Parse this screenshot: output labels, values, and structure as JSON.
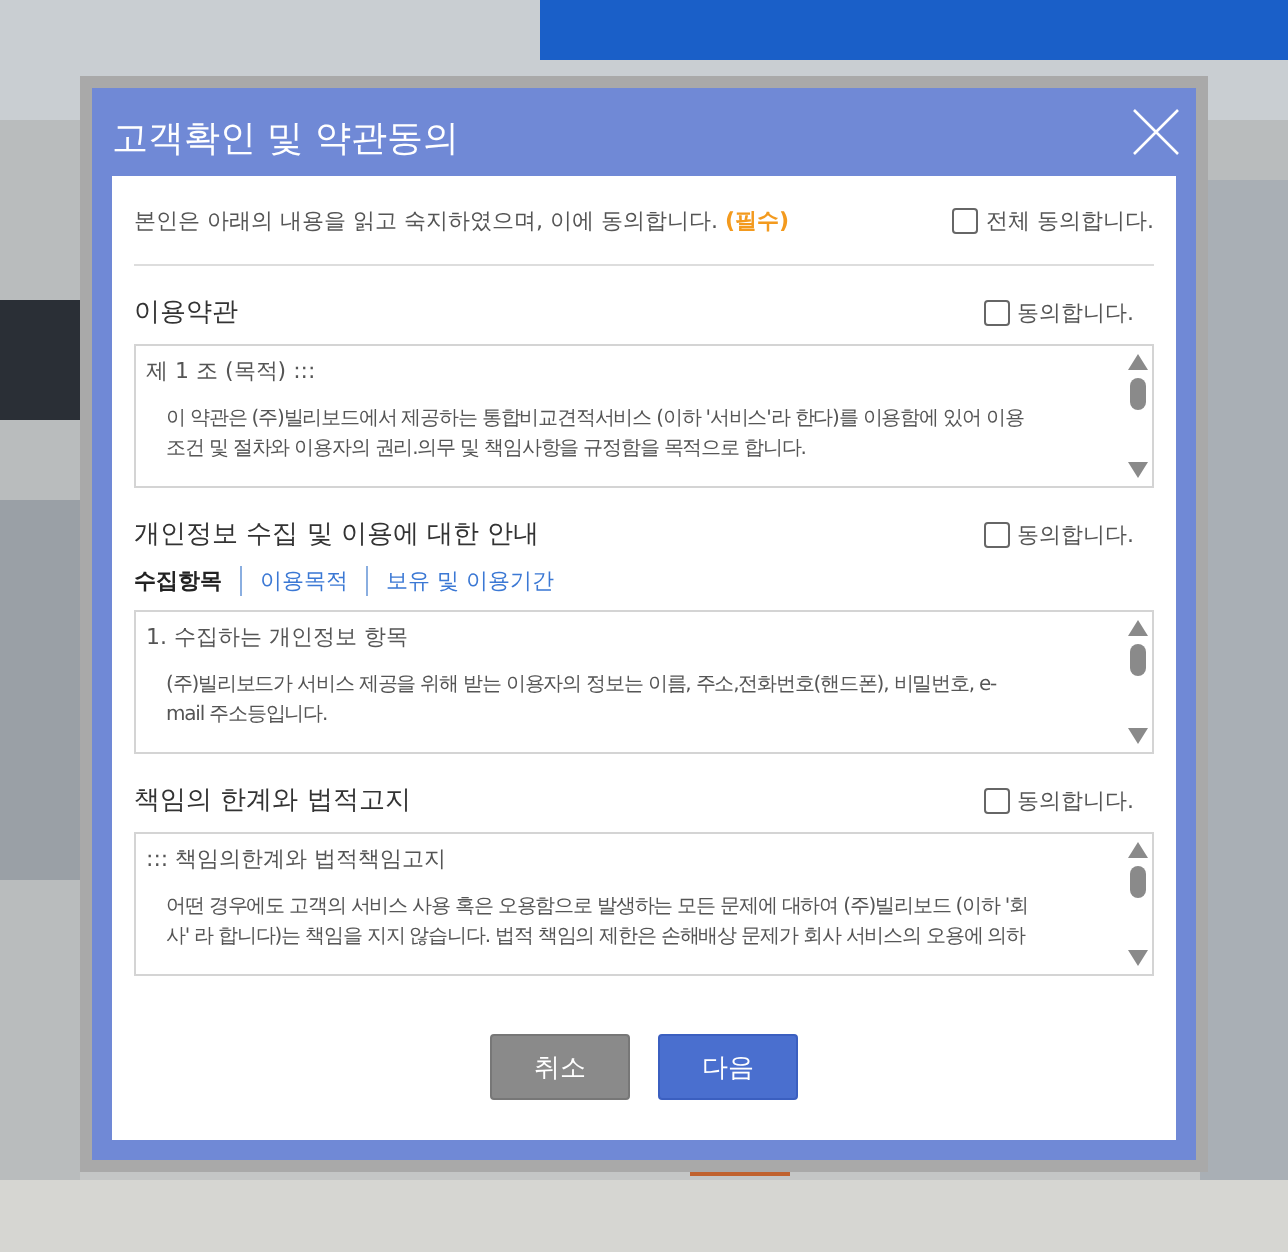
{
  "dialog": {
    "title": "고객확인 및 약관동의",
    "intro": "본인은 아래의 내용을 읽고 숙지하였으며, 이에 동의합니다. **(필수)**",
    "agree_all": {
      "label": "전체 동의합니다.",
      "checked": false
    },
    "sections": [
      {
        "title": "이용약관",
        "agree": {
          "label": "동의합니다.",
          "checked": false
        },
        "content": [
          {
            "kind": "heading",
            "text": "제 1 조 (목적) :::"
          },
          {
            "kind": "paragraph",
            "lines": [
              "이 약관은 (주)빌리보드에서 제공하는 통합비교견적서비스 (이하 '서비스'라 한다)를 이용함에 있어 이용",
              "조건 및 절차와 이용자의 권리.의무 및 책임사항을 규정함을 목적으로 합니다."
            ]
          }
        ]
      },
      {
        "title": "개인정보 수집 및 이용에 대한 안내",
        "agree": {
          "label": "동의합니다.",
          "checked": false
        },
        "tabs": [
          {
            "label": "수집항목",
            "selected": true
          },
          {
            "label": "이용목적",
            "selected": false
          },
          {
            "label": "보유 및 이용기간",
            "selected": false
          }
        ],
        "content": [
          {
            "kind": "heading",
            "text": "1. 수집하는 개인정보 항목"
          },
          {
            "kind": "paragraph",
            "lines": [
              "(주)빌리보드가 서비스 제공을 위해 받는 이용자의 정보는 이름, 주소,전화번호(핸드폰), 비밀번호, e-",
              "mail 주소등입니다."
            ]
          }
        ]
      },
      {
        "title": "책임의 한계와 법적고지",
        "agree": {
          "label": "동의합니다.",
          "checked": false
        },
        "content": [
          {
            "kind": "heading",
            "text": "::: 책임의한계와 법적책임고지"
          },
          {
            "kind": "paragraph",
            "lines": [
              "어떤 경우에도 고객의 서비스 사용 혹은 오용함으로 발생하는 모든 문제에 대하여 (주)빌리보드 (이하 '회",
              "사' 라 합니다)는 책임을 지지 않습니다. 법적 책임의 제한은 손해배상 문제가 회사 서비스의 오용에 의하"
            ]
          }
        ]
      }
    ],
    "buttons": [
      {
        "label": "취소",
        "kind": "secondary"
      },
      {
        "label": "다음",
        "kind": "primary"
      }
    ]
  }
}
